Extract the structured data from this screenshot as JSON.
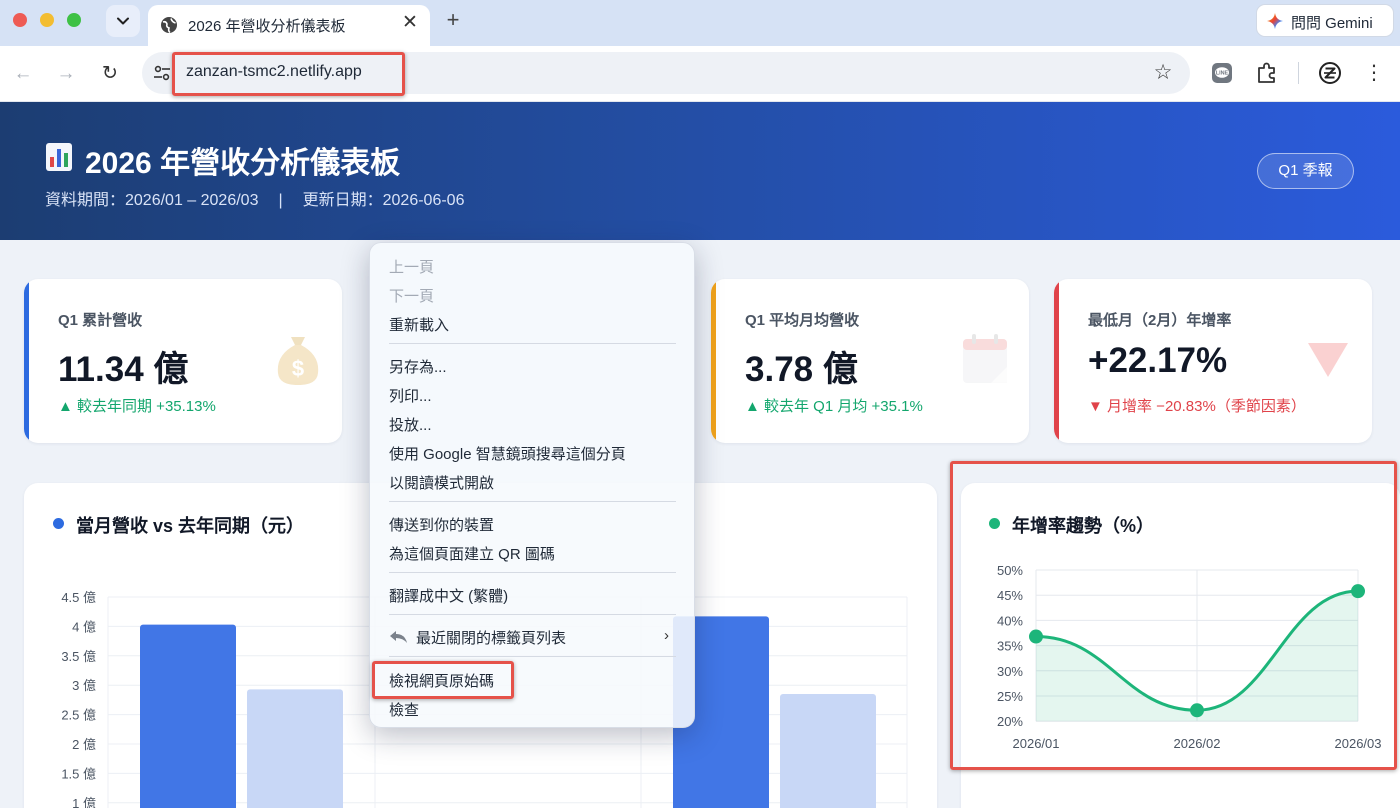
{
  "browser": {
    "tab_title": "2026 年營收分析儀表板",
    "tab_close": "✕",
    "tab_new": "+",
    "tab_menu": "⌄",
    "gemini_label": "問問 Gemini",
    "url": "zanzan-tsmc2.netlify.app",
    "back": "←",
    "forward": "→",
    "reload": "↻",
    "bookmark": "☆",
    "more": "⋮"
  },
  "header": {
    "title": "2026 年營收分析儀表板",
    "period": "資料期間：2026/01 – 2026/03",
    "divider": "|",
    "updated": "更新日期：2026-06-06",
    "badge": "Q1 季報"
  },
  "kpis": [
    {
      "label": "Q1 累計營收",
      "value": "11.34 億",
      "delta": "▲ 較去年同期 +35.13%",
      "trend": "up",
      "icon": "money-bag-icon",
      "accent": "#2d6be0"
    },
    {
      "label": "",
      "value": "",
      "delta": "",
      "trend": "up",
      "icon": "",
      "accent": "#13a66d"
    },
    {
      "label": "Q1 平均月均營收",
      "value": "3.78 億",
      "delta": "▲ 較去年 Q1 月均 +35.1%",
      "trend": "up",
      "icon": "calendar-icon",
      "accent": "#f0a21a"
    },
    {
      "label": "最低月（2月）年增率",
      "value": "+22.17%",
      "delta": "▼ 月增率 −20.83%（季節因素）",
      "trend": "down",
      "icon": "down-triangle-icon",
      "accent": "#e0434a"
    }
  ],
  "bar_chart_card": {
    "title": "當月營收 vs 去年同期（元）",
    "dot_color": "#2d6be0"
  },
  "line_chart_card": {
    "title": "年增率趨勢（%）",
    "dot_color": "#1db57a"
  },
  "chart_data": [
    {
      "type": "bar",
      "title": "當月營收 vs 去年同期（元）",
      "y_ticks": [
        "4.5 億",
        "4 億",
        "3.5 億",
        "3 億",
        "2.5 億",
        "2 億",
        "1.5 億",
        "1 億"
      ],
      "ylim": [
        1,
        4.5
      ],
      "series": [
        {
          "values": [
            4.03,
            null,
            4.17
          ],
          "color": "#4176e6"
        },
        {
          "values": [
            2.93,
            null,
            2.85
          ],
          "color": "#c8d7f6"
        }
      ],
      "note": ""
    },
    {
      "type": "line",
      "title": "年增率趨勢（%）",
      "categories": [
        "2026/01",
        "2026/02",
        "2026/03"
      ],
      "y_ticks": [
        "50%",
        "45%",
        "40%",
        "35%",
        "30%",
        "25%",
        "20%"
      ],
      "ylim": [
        20,
        50
      ],
      "series": [
        {
          "values": [
            36.8,
            22.17,
            45.8
          ],
          "color": "#1db57a"
        }
      ],
      "grid": true
    }
  ],
  "context_menu": {
    "items": [
      {
        "label": "上一頁",
        "disabled": true
      },
      {
        "label": "下一頁",
        "disabled": true
      },
      {
        "label": "重新載入"
      },
      {
        "label": "另存為..."
      },
      {
        "label": "列印..."
      },
      {
        "label": "投放..."
      },
      {
        "label": "使用 Google 智慧鏡頭搜尋這個分頁"
      },
      {
        "label": "以閱讀模式開啟"
      },
      {
        "label": "傳送到你的裝置"
      },
      {
        "label": "為這個頁面建立 QR 圖碼"
      },
      {
        "label": "翻譯成中文 (繁體)"
      },
      {
        "label": "最近關閉的標籤頁列表",
        "submenu": "›"
      },
      {
        "label": "檢視網頁原始碼"
      },
      {
        "label": "檢查"
      }
    ]
  }
}
